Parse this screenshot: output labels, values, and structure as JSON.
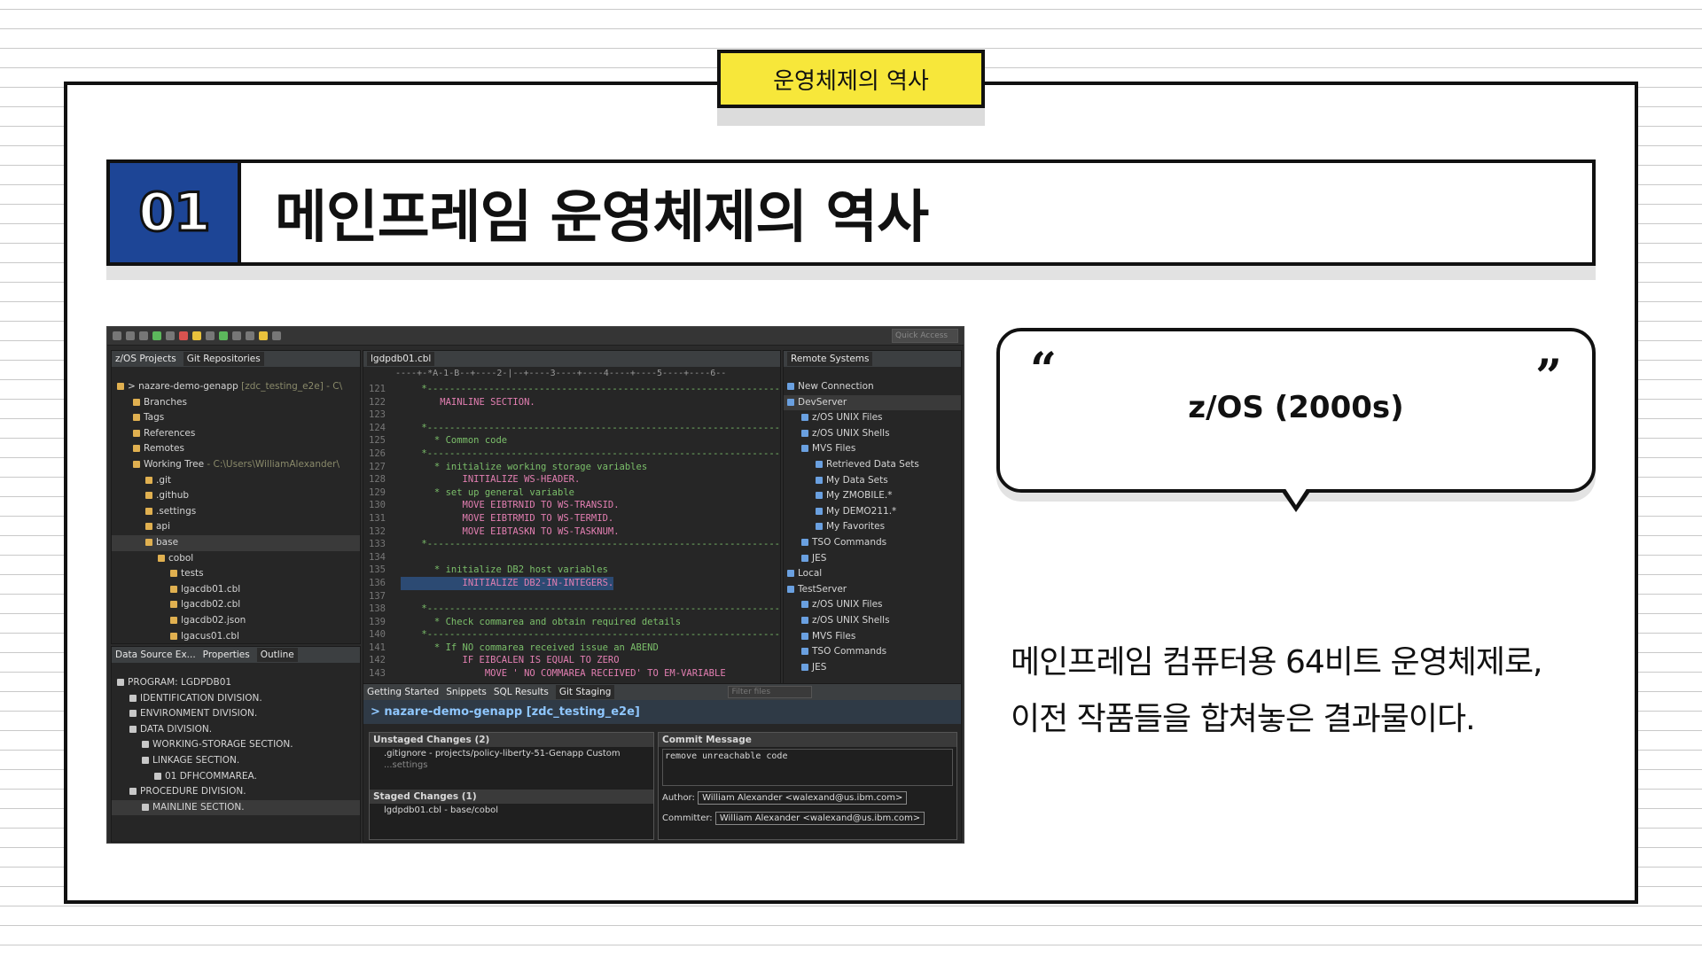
{
  "header_tag": "운영체제의 역사",
  "title": {
    "number": "01",
    "text": "메인프레임 운영체제의 역사"
  },
  "quote": {
    "open": "“",
    "close": "”",
    "text": "z/OS (2000s)"
  },
  "description": [
    "메인프레임 컴퓨터용 64비트 운영체제로,",
    "이전 작품들을 합쳐놓은 결과물이다."
  ],
  "ide": {
    "quick_access": "Quick Access",
    "left_tabs": [
      "z/OS Projects",
      "Git Repositories"
    ],
    "left_tree": [
      {
        "text": "> nazare-demo-genapp",
        "dim": " [zdc_testing_e2e] - C\\"
      },
      {
        "text": "Branches"
      },
      {
        "text": "Tags"
      },
      {
        "text": "References"
      },
      {
        "text": "Remotes"
      },
      {
        "text": "Working Tree",
        "dim": " - C:\\Users\\WilliamAlexander\\"
      },
      {
        "text": ".git"
      },
      {
        "text": ".github"
      },
      {
        "text": ".settings"
      },
      {
        "text": "api"
      },
      {
        "text": "base"
      },
      {
        "text": "cobol"
      },
      {
        "text": "tests"
      },
      {
        "text": "lgacdb01.cbl"
      },
      {
        "text": "lgacdb02.cbl"
      },
      {
        "text": "lgacdb02.json"
      },
      {
        "text": "lgacus01.cbl"
      }
    ],
    "editor_tab": "lgdpdb01.cbl",
    "ruler": "----+-*A-1-B--+----2-|--+----3----+----4----+----5----+----6--",
    "code_lines": [
      {
        "n": "121",
        "t": "      *---------------------------------------------------------------",
        "c": "c-green"
      },
      {
        "n": "122",
        "t": "       MAINLINE SECTION.",
        "c": "c-pink"
      },
      {
        "n": "123",
        "t": "",
        "c": ""
      },
      {
        "n": "124",
        "t": "      *---------------------------------------------------------------",
        "c": "c-green"
      },
      {
        "n": "125",
        "t": "      * Common code",
        "c": "c-green"
      },
      {
        "n": "126",
        "t": "      *---------------------------------------------------------------",
        "c": "c-green"
      },
      {
        "n": "127",
        "t": "      * initialize working storage variables",
        "c": "c-green"
      },
      {
        "n": "128",
        "t": "           INITIALIZE WS-HEADER.",
        "c": "c-pink"
      },
      {
        "n": "129",
        "t": "      * set up general variable",
        "c": "c-green"
      },
      {
        "n": "130",
        "t": "           MOVE EIBTRNID TO WS-TRANSID.",
        "c": "c-pink"
      },
      {
        "n": "131",
        "t": "           MOVE EIBTRMID TO WS-TERMID.",
        "c": "c-pink"
      },
      {
        "n": "132",
        "t": "           MOVE EIBTASKN TO WS-TASKNUM.",
        "c": "c-pink"
      },
      {
        "n": "133",
        "t": "      *---------------------------------------------------------------",
        "c": "c-green"
      },
      {
        "n": "134",
        "t": "",
        "c": ""
      },
      {
        "n": "135",
        "t": "      * initialize DB2 host variables",
        "c": "c-green"
      },
      {
        "n": "136",
        "t": "           INITIALIZE DB2-IN-INTEGERS.",
        "c": "c-pink c-hl"
      },
      {
        "n": "137",
        "t": "",
        "c": ""
      },
      {
        "n": "138",
        "t": "      *---------------------------------------------------------------",
        "c": "c-green"
      },
      {
        "n": "139",
        "t": "      * Check commarea and obtain required details",
        "c": "c-green"
      },
      {
        "n": "140",
        "t": "      *---------------------------------------------------------------",
        "c": "c-green"
      },
      {
        "n": "141",
        "t": "      * If NO commarea received issue an ABEND",
        "c": "c-green"
      },
      {
        "n": "142",
        "t": "           IF EIBCALEN IS EQUAL TO ZERO",
        "c": "c-pink"
      },
      {
        "n": "143",
        "t": "               MOVE ' NO COMMAREA RECEIVED' TO EM-VARIABLE",
        "c": "c-pink"
      }
    ],
    "remote_tab": "Remote Systems",
    "remote_tree": [
      "New Connection",
      "DevServer",
      "z/OS UNIX Files",
      "z/OS UNIX Shells",
      "MVS Files",
      "Retrieved Data Sets",
      "My Data Sets",
      "My ZMOBILE.*",
      "My DEMO211.*",
      "My Favorites",
      "TSO Commands",
      "JES",
      "Local",
      "TestServer",
      "z/OS UNIX Files",
      "z/OS UNIX Shells",
      "MVS Files",
      "TSO Commands",
      "JES"
    ],
    "outline_tabs": [
      "Data Source Ex...",
      "Properties",
      "Outline"
    ],
    "outline_tree": [
      "PROGRAM: LGDPDB01",
      "IDENTIFICATION DIVISION.",
      "ENVIRONMENT DIVISION.",
      "DATA DIVISION.",
      "WORKING-STORAGE SECTION.",
      "LINKAGE SECTION.",
      "01  DFHCOMMAREA.",
      "PROCEDURE DIVISION.",
      "MAINLINE SECTION."
    ],
    "bottom_tabs": [
      "Getting Started",
      "Snippets",
      "SQL Results",
      "Git Staging"
    ],
    "filter_placeholder": "Filter files",
    "staging_title": "> nazare-demo-genapp [zdc_testing_e2e]",
    "unstaged_label": "Unstaged Changes (2)",
    "unstaged_items": [
      ".gitignore - projects/policy-liberty-51-Genapp Custom",
      "...settings"
    ],
    "staged_label": "Staged Changes (1)",
    "staged_items": [
      "lgdpdb01.cbl - base/cobol"
    ],
    "commit_label": "Commit Message",
    "commit_text": "remove unreachable code",
    "author_label": "Author:",
    "author_value": "William Alexander <walexand@us.ibm.com>",
    "committer_label": "Committer:",
    "committer_value": "William Alexander <walexand@us.ibm.com>"
  }
}
